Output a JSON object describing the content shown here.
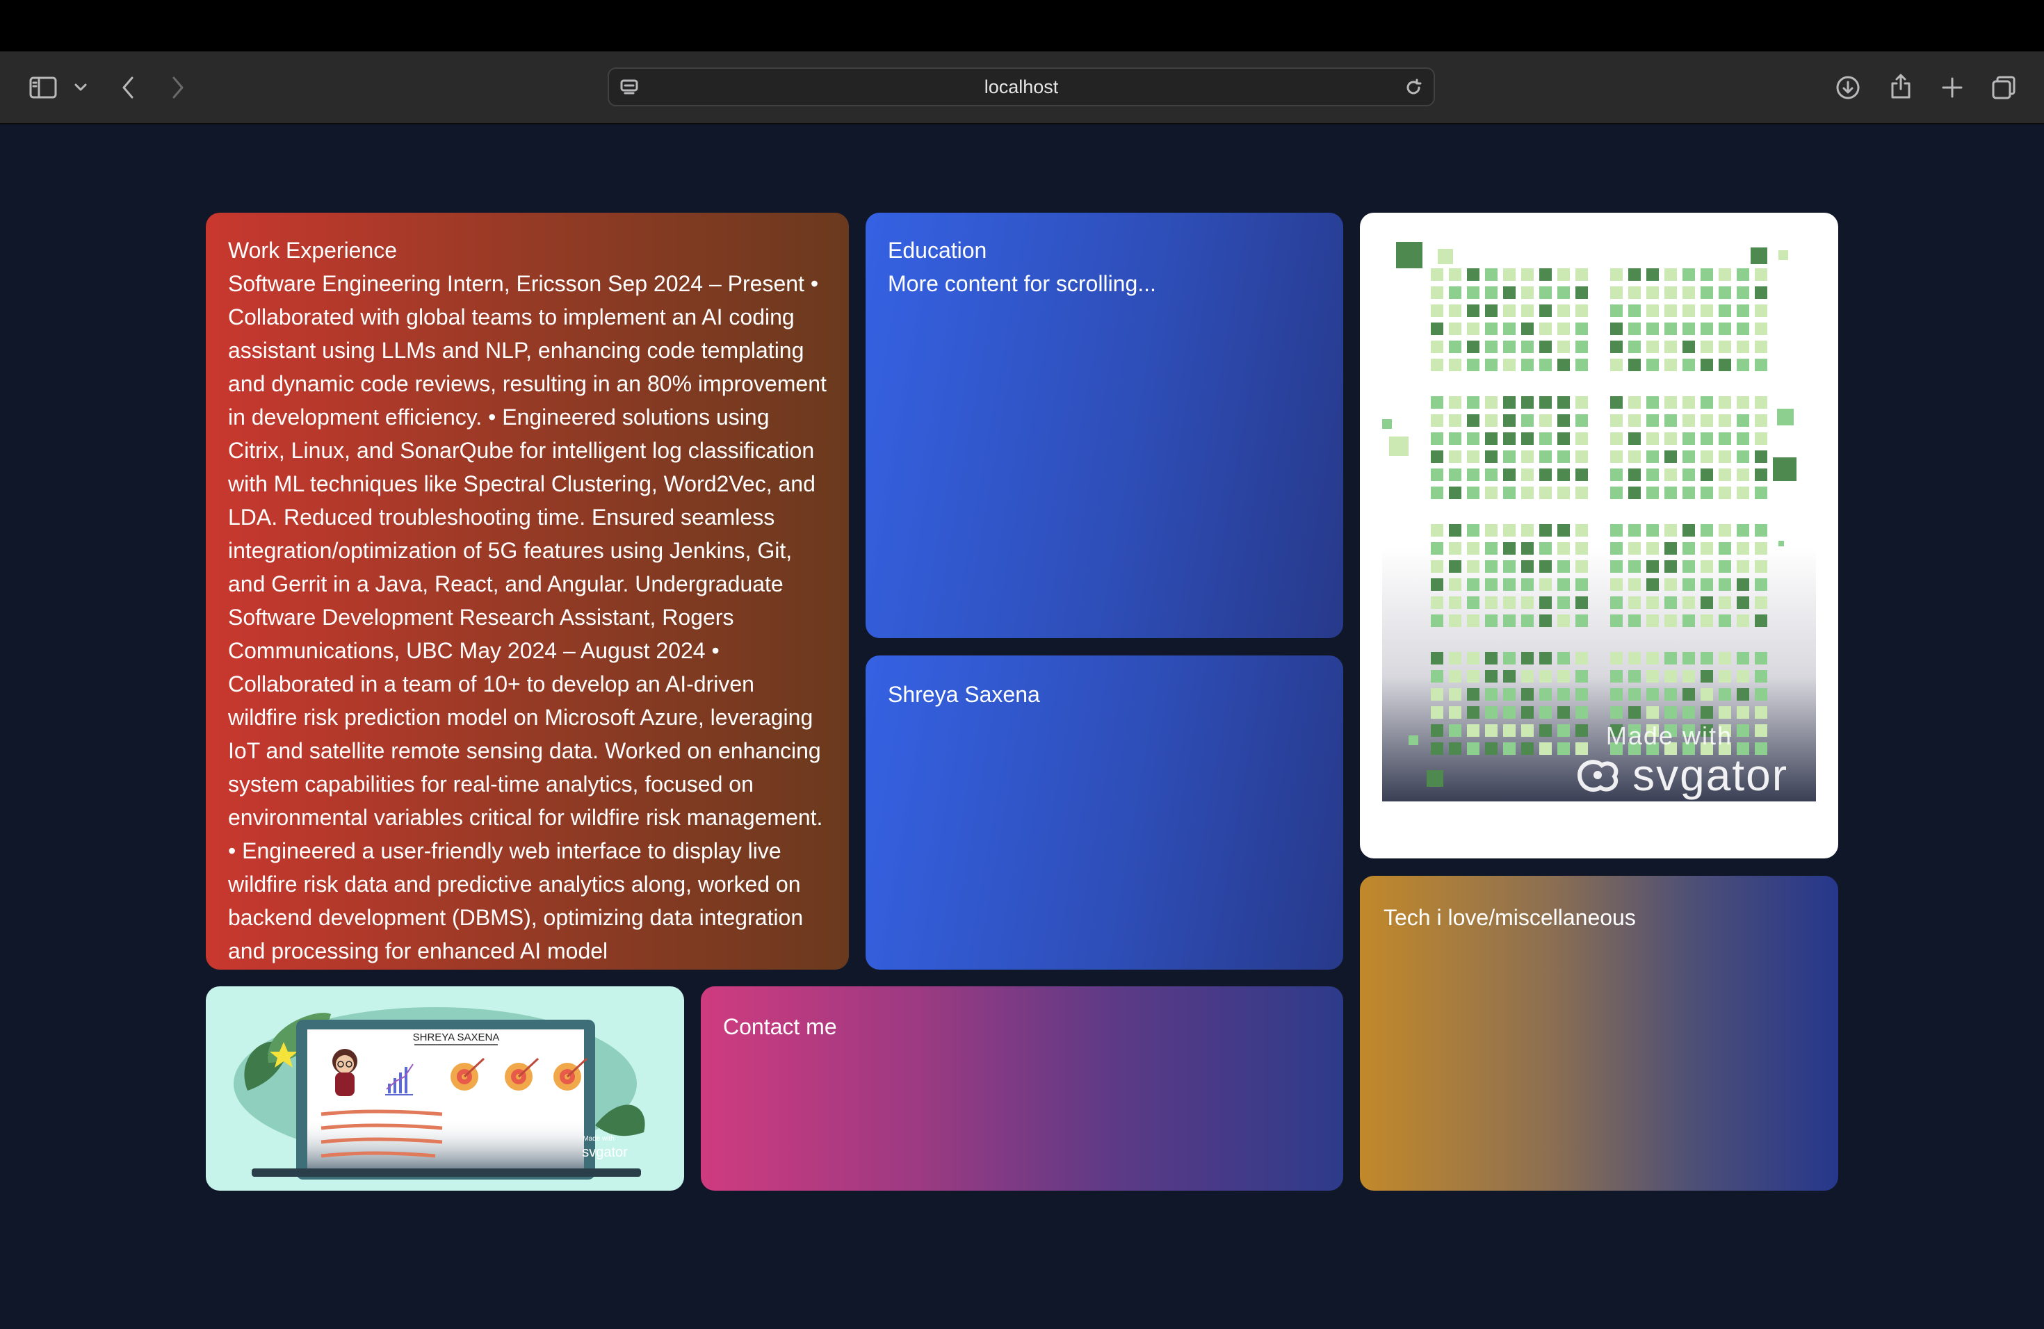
{
  "browser": {
    "url": "localhost"
  },
  "work": {
    "title": "Work Experience",
    "body": "Software Engineering Intern, Ericsson Sep 2024 – Present • Collaborated with global teams to implement an AI coding assistant using LLMs and NLP, enhancing code templating and dynamic code reviews, resulting in an 80% improvement in development efficiency. • Engineered solutions using Citrix, Linux, and SonarQube for intelligent log classification with ML techniques like Spectral Clustering, Word2Vec, and LDA. Reduced troubleshooting time. Ensured seamless integration/optimization of 5G features using Jenkins, Git, and Gerrit in a Java, React, and Angular. Undergraduate Software Development Research Assistant, Rogers Communications, UBC May 2024 – August 2024 • Collaborated in a team of 10+ to develop an AI-driven wildfire risk prediction model on Microsoft Azure, leveraging IoT and satellite remote sensing data. Worked on enhancing system capabilities for real-time analytics, focused on environmental variables critical for wildfire risk management. • Engineered a user-friendly web interface to display live wildfire risk data and predictive analytics along, worked on backend development (DBMS), optimizing data integration and processing for enhanced AI model"
  },
  "education": {
    "title": "Education",
    "body": "More content for scrolling..."
  },
  "name_card": {
    "title": "Shreya Saxena"
  },
  "svg_card": {
    "made_with": "Made with",
    "brand": "svgator"
  },
  "tech": {
    "title": "Tech i love/miscellaneous"
  },
  "illustration": {
    "nameplate": "SHREYA SAXENA",
    "made_with": "Made with",
    "brand": "svgator"
  },
  "contact": {
    "title": "Contact me"
  },
  "colors": {
    "page_bg": "#101728",
    "green_dark": "#4e8a50",
    "green_mid": "#8ccf8e",
    "green_light": "#cde9b3"
  }
}
